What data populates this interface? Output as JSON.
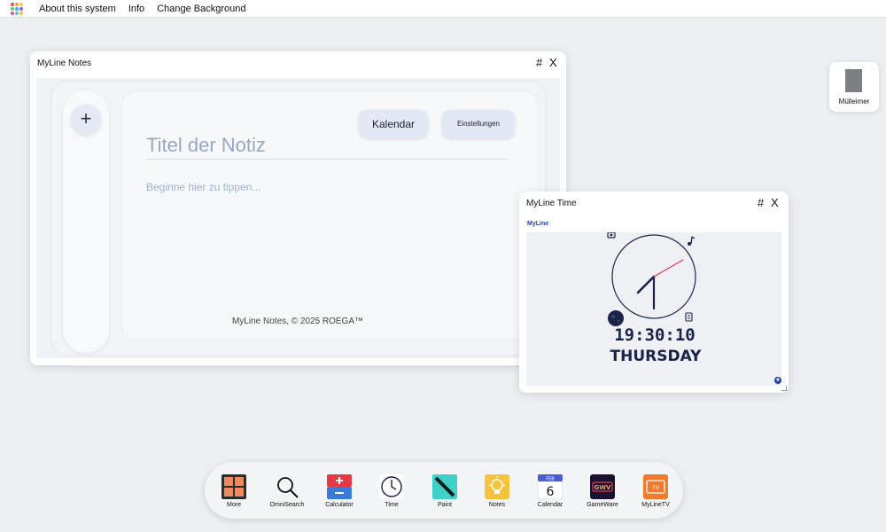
{
  "menubar": {
    "items": [
      "About this system",
      "Info",
      "Change Background"
    ],
    "logo_colors": [
      "#e84d4d",
      "#f2a33a",
      "#f4d03f",
      "#5cc86a",
      "#3fa9f5",
      "#8a5cf5",
      "#e84d9b",
      "#4dd0c8",
      "#ffb347"
    ]
  },
  "notes_window": {
    "title": "MyLine Notes",
    "hash": "#",
    "close": "X",
    "add_label": "+",
    "calendar_label": "Kalendar",
    "settings_label": "Einstellungen",
    "title_placeholder": "Titel der Notiz",
    "text_placeholder": "Beginne hier zu tippen...",
    "footer": "MyLine Notes, © 2025 ROEGA™"
  },
  "time_window": {
    "title": "MyLine Time",
    "hash": "#",
    "close": "X",
    "brand": "MyLine",
    "time": "19:30:10",
    "day": "THURSDAY",
    "icons": [
      "camera-icon",
      "music-note-icon",
      "moon-icon",
      "clipboard-icon",
      "account-icon"
    ],
    "colors": {
      "navy": "#1b2348",
      "second_hand": "#e23a4e",
      "brand_blue": "#2144a8"
    }
  },
  "trash": {
    "label": "Mülleimer"
  },
  "dock": {
    "items": [
      {
        "label": "More",
        "icon": "grid-icon"
      },
      {
        "label": "OmniSearch",
        "icon": "search-icon"
      },
      {
        "label": "Calculator",
        "icon": "calculator-icon"
      },
      {
        "label": "Time",
        "icon": "clock-icon"
      },
      {
        "label": "Paint",
        "icon": "paint-icon"
      },
      {
        "label": "Notes",
        "icon": "lightbulb-icon"
      },
      {
        "label": "Calendar",
        "icon": "calendar-icon",
        "month": "FEB",
        "day": "6"
      },
      {
        "label": "GameWare",
        "icon": "gameware-icon",
        "text": "GWV"
      },
      {
        "label": "MyLineTV",
        "icon": "tv-icon",
        "text": "TV"
      }
    ]
  }
}
